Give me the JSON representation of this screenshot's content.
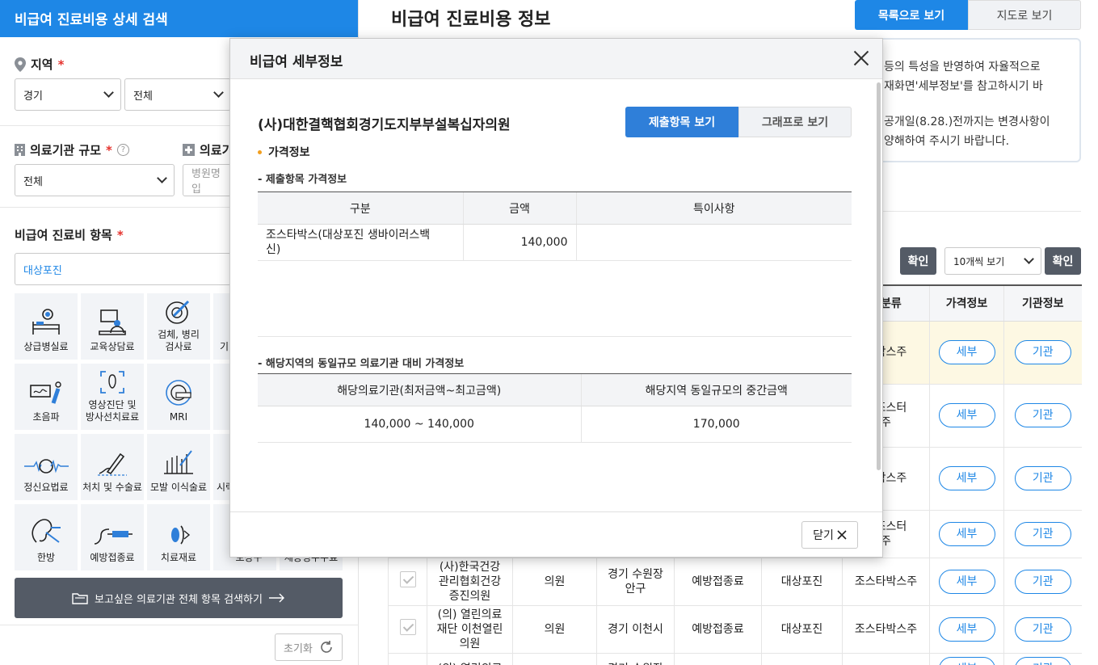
{
  "sidebar": {
    "title": "비급여 진료비용 상세 검색",
    "region": {
      "label": "지역",
      "required": "*",
      "province": "경기",
      "district": "전체"
    },
    "scale": {
      "label": "의료기관 규모",
      "required": "*",
      "help": "?",
      "value": "전체"
    },
    "name": {
      "label": "의료기",
      "placeholder": "병원명 입"
    },
    "items": {
      "label": "비급여 진료비 항목",
      "required": "*",
      "search_value": "대상포진"
    },
    "tiles": [
      {
        "label": "상급병실료",
        "icon": "hospital-bed-icon"
      },
      {
        "label": "교육상담료",
        "icon": "counseling-icon"
      },
      {
        "label": "검체, 병리\n검사료",
        "icon": "pathology-test-icon"
      },
      {
        "label": "기",
        "icon": "partial-icon"
      },
      {
        "label": "",
        "icon": "hidden-icon"
      },
      {
        "label": "초음파",
        "icon": "ultrasound-icon"
      },
      {
        "label": "영상진단 및\n방사선치료료",
        "icon": "radiology-icon"
      },
      {
        "label": "MRI",
        "icon": "mri-icon"
      },
      {
        "label": "",
        "icon": "hidden-icon"
      },
      {
        "label": "",
        "icon": "hidden-icon"
      },
      {
        "label": "정신요법료",
        "icon": "psychotherapy-icon"
      },
      {
        "label": "처치 및 수술료",
        "icon": "surgery-icon"
      },
      {
        "label": "모발 이식술료",
        "icon": "hair-transplant-icon"
      },
      {
        "label": "시력",
        "icon": "partial-icon"
      },
      {
        "label": "",
        "icon": "hidden-icon"
      },
      {
        "label": "한방",
        "icon": "oriental-medicine-icon"
      },
      {
        "label": "예방접종료",
        "icon": "vaccination-icon"
      },
      {
        "label": "치료재료",
        "icon": "treatment-material-icon"
      },
      {
        "label": "보장구",
        "icon": "partial-icon"
      },
      {
        "label": "제증명수수료",
        "icon": "partial-icon"
      }
    ],
    "search_all": "보고싶은 의료기관 전체 항목 검색하기",
    "reset": "초기화"
  },
  "main": {
    "title": "비급여 진료비용 정보",
    "view_list": "목록으로 보기",
    "view_map": "지도로 보기",
    "notice_lines": [
      "등의 특성을 반영하여 자율적으로",
      "재화면'세부정보'를 참고하시기 바"
    ],
    "notice_lines2": [
      "공개일(8.28.)전까지는 변경사항이",
      "양해하여 주시기 바랍니다."
    ],
    "confirm1": "확인",
    "per_page": "10개씩 보기",
    "confirm2": "확인",
    "table": {
      "headers": [
        "",
        "",
        "",
        "",
        "",
        "",
        "세분류",
        "가격정보",
        "기관정보"
      ],
      "rows": [
        {
          "check": false,
          "name": "",
          "type": "",
          "region": "",
          "cat": "",
          "mid": "",
          "sub": "타박스주",
          "detail": "세부",
          "inst": "기관",
          "hl": true
        },
        {
          "check": false,
          "name": "",
          "type": "",
          "region": "",
          "cat": "",
          "mid": "",
          "sub": "이조스터\n주",
          "detail": "세부",
          "inst": "기관",
          "hl": false
        },
        {
          "check": false,
          "name": "",
          "type": "",
          "region": "",
          "cat": "",
          "mid": "",
          "sub": "타박스주",
          "detail": "세부",
          "inst": "기관",
          "hl": false
        },
        {
          "check": false,
          "name": "",
          "type": "",
          "region": "",
          "cat": "",
          "mid": "",
          "sub": "이조스터\n주",
          "detail": "세부",
          "inst": "기관",
          "hl": false
        },
        {
          "check": true,
          "name": "(사)한국건강\n관리협회건강\n증진의원",
          "type": "의원",
          "region": "경기 수원장\n안구",
          "cat": "예방접종료",
          "mid": "대상포진",
          "sub": "조스타박스주",
          "detail": "세부",
          "inst": "기관",
          "hl": false
        },
        {
          "check": true,
          "name": "(의) 열린의료\n재단 이천열린\n의원",
          "type": "의원",
          "region": "경기 이천시",
          "cat": "예방접종료",
          "mid": "대상포진",
          "sub": "조스타박스주",
          "detail": "세부",
          "inst": "기관",
          "hl": false
        },
        {
          "check": false,
          "name": "(의) 열린의료",
          "type": "",
          "region": "경기 수원장",
          "cat": "",
          "mid": "",
          "sub": "",
          "detail": "세부",
          "inst": "기관",
          "hl": false
        }
      ]
    }
  },
  "modal": {
    "title": "비급여 세부정보",
    "org_name": "(사)대한결핵협회경기도지부부설복십자의원",
    "tab_items": "제출항목 보기",
    "tab_graph": "그래프로 보기",
    "section": "가격정보",
    "sub1": "- 제출항목 가격정보",
    "t1_headers": [
      "구분",
      "금액",
      "특이사항"
    ],
    "t1_row": {
      "item": "조스타박스(대상포진 생바이러스백\n신)",
      "price": "140,000",
      "note": ""
    },
    "sub2": "- 해당지역의 동일규모 의료기관 대비 가격정보",
    "t2_headers": [
      "해당의료기관(최저금액~최고금액)",
      "해당지역 동일규모의 중간금액"
    ],
    "t2_row": {
      "range": "140,000 ~ 140,000",
      "median": "170,000"
    },
    "close": "닫기"
  }
}
